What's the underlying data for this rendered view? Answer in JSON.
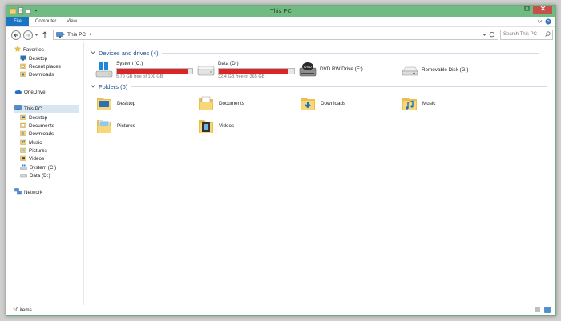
{
  "window": {
    "title": "This PC"
  },
  "colors": {
    "titlebar": "#6fbb81",
    "file_tab": "#1a74c1",
    "close_button": "#c7504a",
    "drive_bar_fill": "#da2626",
    "group_heading": "#1e4e8f"
  },
  "ribbon": {
    "tabs": [
      {
        "label": "File"
      },
      {
        "label": "Computer"
      },
      {
        "label": "View"
      }
    ]
  },
  "address": {
    "crumb": "This PC",
    "search_placeholder": "Search This PC"
  },
  "nav": {
    "favorites": {
      "label": "Favorites",
      "items": [
        {
          "label": "Desktop"
        },
        {
          "label": "Recent places"
        },
        {
          "label": "Downloads"
        }
      ]
    },
    "onedrive": {
      "label": "OneDrive"
    },
    "thispc": {
      "label": "This PC",
      "items": [
        {
          "label": "Desktop"
        },
        {
          "label": "Documents"
        },
        {
          "label": "Downloads"
        },
        {
          "label": "Music"
        },
        {
          "label": "Pictures"
        },
        {
          "label": "Videos"
        },
        {
          "label": "System (C:)"
        },
        {
          "label": "Data (D:)"
        }
      ]
    },
    "network": {
      "label": "Network"
    }
  },
  "devices": {
    "heading": "Devices and drives (4)",
    "drives": [
      {
        "name": "System (C:)",
        "free_text": "5.79 GB free of 100 GB",
        "used_fraction": 0.942,
        "icon": "windows-drive-icon"
      },
      {
        "name": "Data (D:)",
        "free_text": "32.4 GB free of 365 GB",
        "used_fraction": 0.911,
        "icon": "hard-drive-icon"
      },
      {
        "name": "DVD RW Drive (E:)",
        "icon": "dvd-drive-icon"
      },
      {
        "name": "Removable Disk (G:)",
        "icon": "removable-disk-icon"
      }
    ]
  },
  "folders": {
    "heading": "Folders (6)",
    "items": [
      {
        "label": "Desktop"
      },
      {
        "label": "Documents"
      },
      {
        "label": "Downloads"
      },
      {
        "label": "Music"
      },
      {
        "label": "Pictures"
      },
      {
        "label": "Videos"
      }
    ]
  },
  "status": {
    "count": "10 items"
  }
}
